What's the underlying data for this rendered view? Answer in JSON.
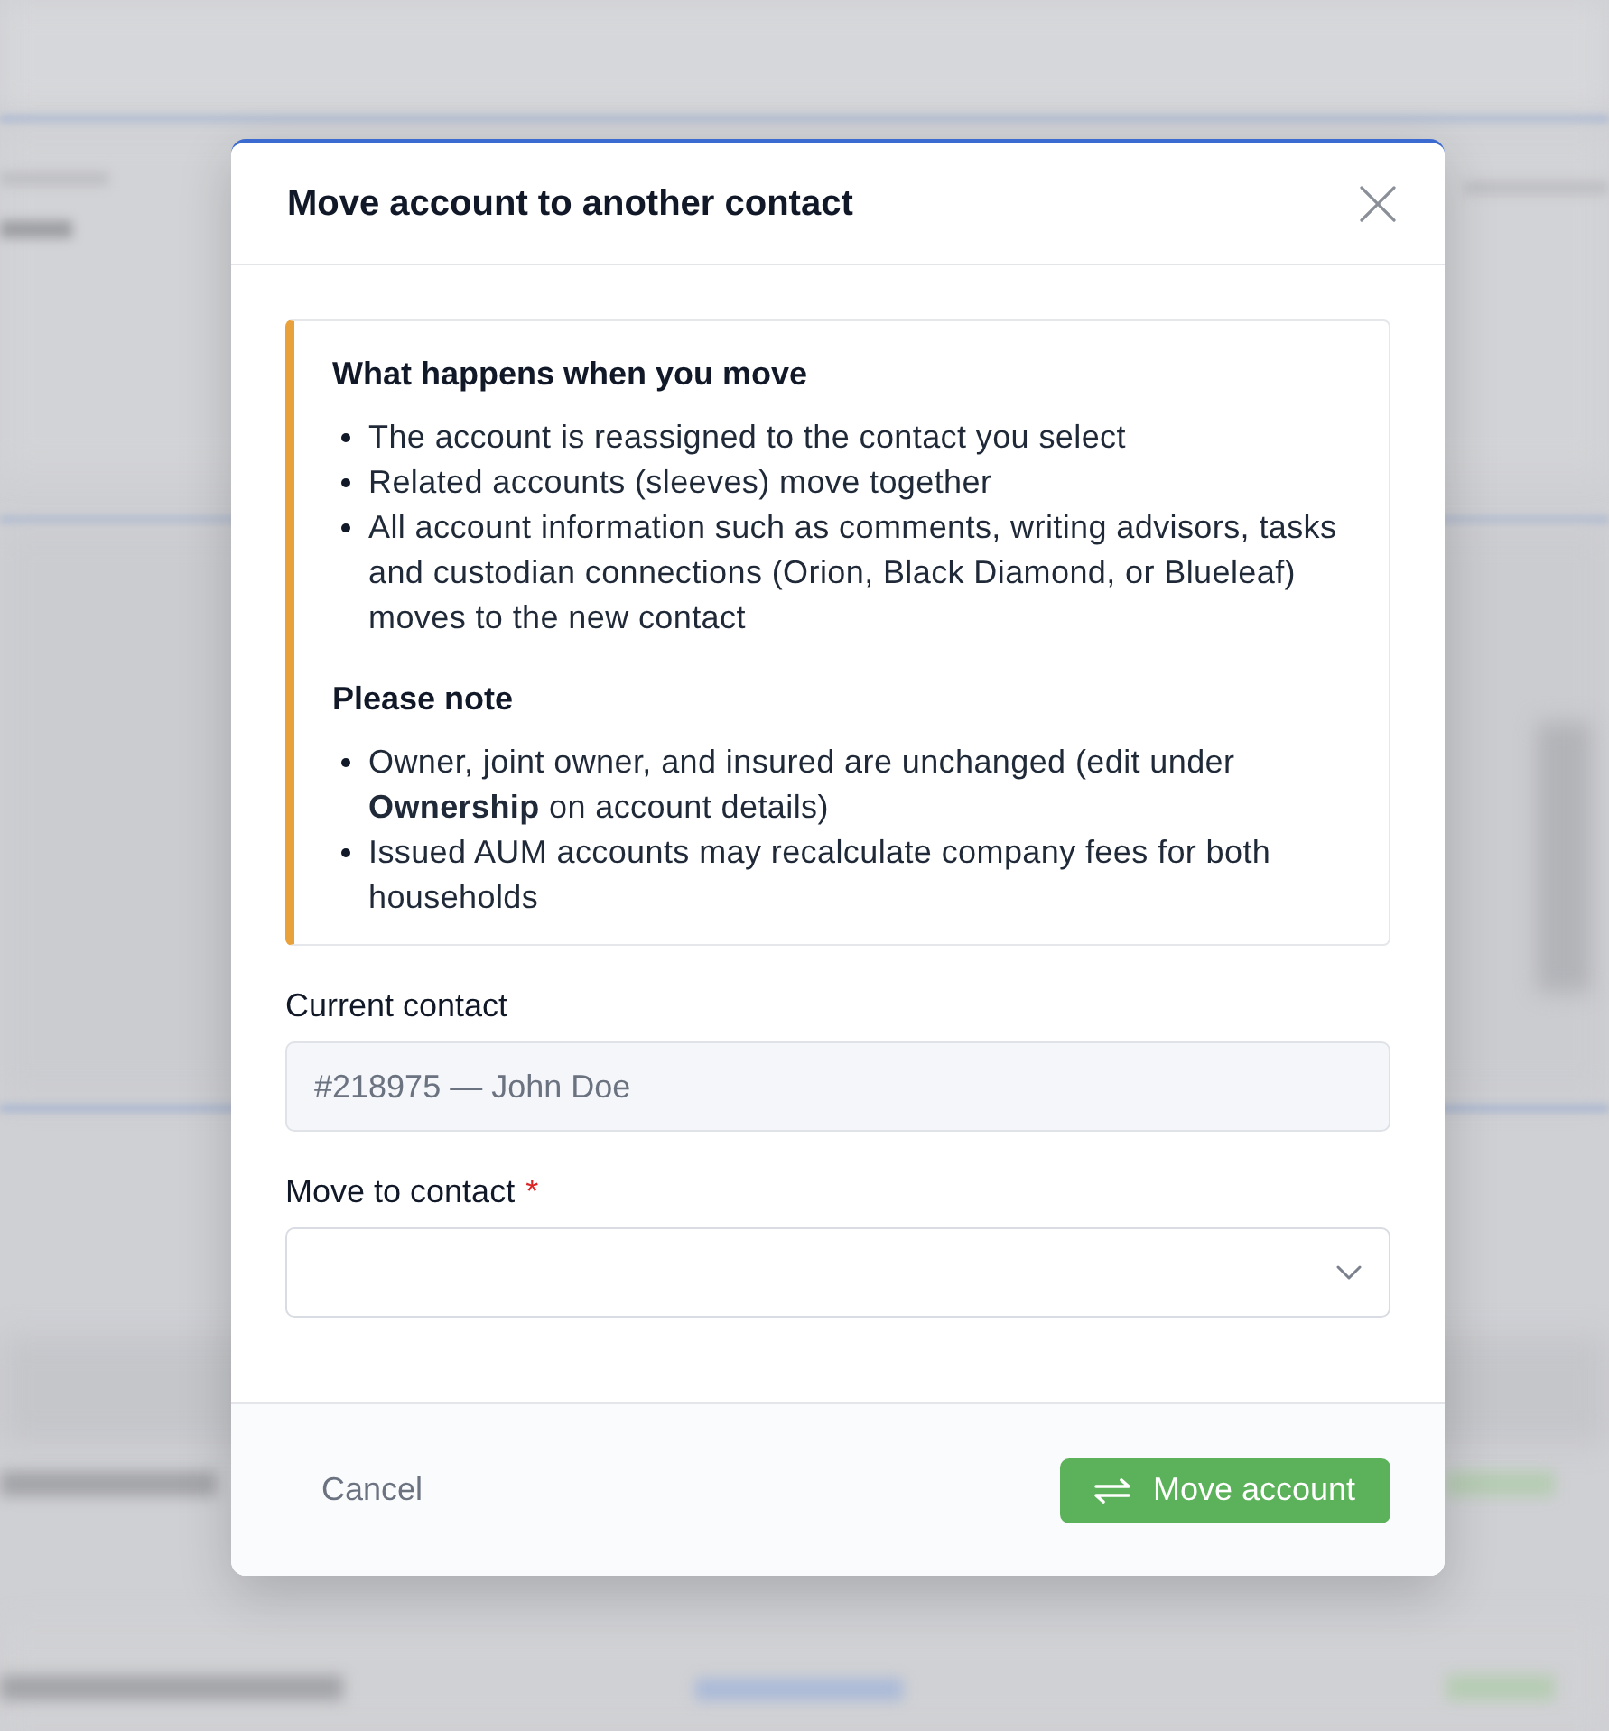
{
  "dialog": {
    "title": "Move account to another contact"
  },
  "notice": {
    "sections": [
      {
        "heading": "What happens when you move",
        "items": [
          "The account is reassigned to the contact you select",
          "Related accounts (sleeves) move together",
          "All account information such as comments, writing advisors, tasks and custodian connections (Orion, Black Diamond, or Blueleaf) moves to the new contact"
        ]
      },
      {
        "heading": "Please note",
        "items": [
          "Owner, joint owner, and insured are unchanged (edit under **Ownership** on account details)",
          "Issued AUM accounts may recalculate company fees for both households"
        ]
      }
    ]
  },
  "fields": [
    {
      "kind": "text",
      "label": "Current contact",
      "value": "#218975 — John Doe",
      "disabled": true
    },
    {
      "kind": "select",
      "label": "Move to contact",
      "required_mark": "*",
      "disabled": false
    }
  ],
  "footer": {
    "cancel": "Cancel",
    "submit": "Move account"
  }
}
